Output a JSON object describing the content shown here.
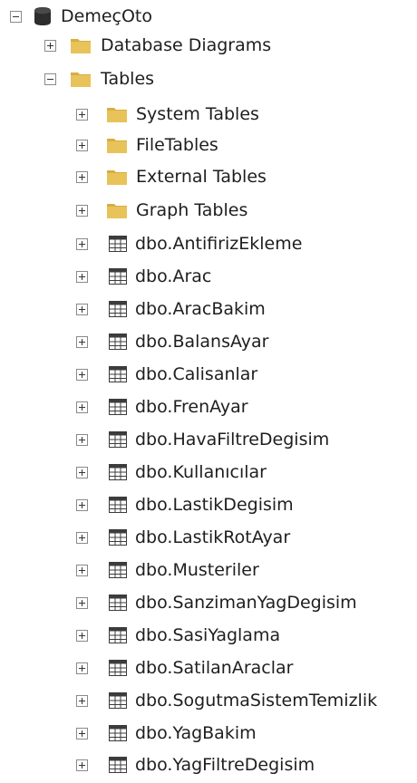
{
  "tree": {
    "database": {
      "label": "DemeçOto",
      "icon": "database-icon",
      "expanded": true
    },
    "folders": [
      {
        "key": "database-diagrams",
        "label": "Database Diagrams",
        "icon": "folder-icon",
        "expanded": false
      },
      {
        "key": "tables",
        "label": "Tables",
        "icon": "folder-icon",
        "expanded": true
      }
    ],
    "table_folders": [
      {
        "key": "system-tables",
        "label": "System Tables",
        "icon": "folder-icon",
        "expanded": false
      },
      {
        "key": "filetables",
        "label": "FileTables",
        "icon": "folder-icon",
        "expanded": false
      },
      {
        "key": "external-tables",
        "label": "External Tables",
        "icon": "folder-icon",
        "expanded": false
      },
      {
        "key": "graph-tables",
        "label": "Graph Tables",
        "icon": "folder-icon",
        "expanded": false
      }
    ],
    "tables": [
      {
        "key": "antifirizekleme",
        "label": "dbo.AntifirizEkleme",
        "icon": "table-icon"
      },
      {
        "key": "arac",
        "label": "dbo.Arac",
        "icon": "table-icon"
      },
      {
        "key": "aracbakim",
        "label": "dbo.AracBakim",
        "icon": "table-icon"
      },
      {
        "key": "balansayar",
        "label": "dbo.BalansAyar",
        "icon": "table-icon"
      },
      {
        "key": "calisanlar",
        "label": "dbo.Calisanlar",
        "icon": "table-icon"
      },
      {
        "key": "frenayar",
        "label": "dbo.FrenAyar",
        "icon": "table-icon"
      },
      {
        "key": "havafiltredegisim",
        "label": "dbo.HavaFiltreDegisim",
        "icon": "table-icon"
      },
      {
        "key": "kullanicilar",
        "label": "dbo.Kullanıcılar",
        "icon": "table-icon"
      },
      {
        "key": "lastikdegisim",
        "label": "dbo.LastikDegisim",
        "icon": "table-icon"
      },
      {
        "key": "lastikrotayar",
        "label": "dbo.LastikRotAyar",
        "icon": "table-icon"
      },
      {
        "key": "musteriler",
        "label": "dbo.Musteriler",
        "icon": "table-icon"
      },
      {
        "key": "sanzimanyagdegisim",
        "label": "dbo.SanzimanYagDegisim",
        "icon": "table-icon"
      },
      {
        "key": "sasiyaglama",
        "label": "dbo.SasiYaglama",
        "icon": "table-icon"
      },
      {
        "key": "satilanaraclar",
        "label": "dbo.SatilanAraclar",
        "icon": "table-icon"
      },
      {
        "key": "sogutmasistemtemizlik",
        "label": "dbo.SogutmaSistemTemizlik",
        "icon": "table-icon"
      },
      {
        "key": "yagbakim",
        "label": "dbo.YagBakim",
        "icon": "table-icon"
      },
      {
        "key": "yagfiltredegisim",
        "label": "dbo.YagFiltreDegisim",
        "icon": "table-icon"
      }
    ]
  },
  "colors": {
    "folder": "#e8c35a",
    "folder_tab": "#d9ad3f",
    "database": "#2d2d2d",
    "table_grid": "#3c3c3c",
    "toggle_border": "#8a8a8a",
    "text": "#1e1e1e"
  }
}
